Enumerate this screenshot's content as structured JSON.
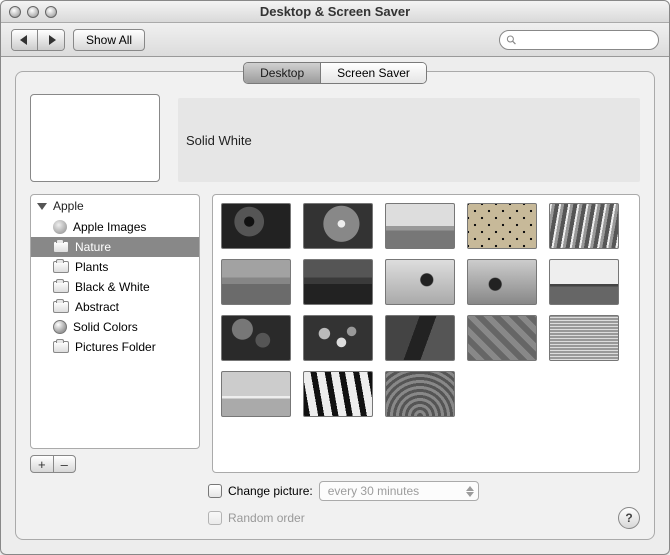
{
  "window": {
    "title": "Desktop & Screen Saver"
  },
  "toolbar": {
    "show_all": "Show All",
    "search_placeholder": ""
  },
  "tabs": {
    "desktop": "Desktop",
    "screensaver": "Screen Saver",
    "selected": "desktop"
  },
  "current": {
    "name": "Solid White"
  },
  "sidebar": {
    "group": "Apple",
    "items": [
      {
        "label": "Apple Images",
        "icon": "apple"
      },
      {
        "label": "Nature",
        "icon": "folder",
        "selected": true
      },
      {
        "label": "Plants",
        "icon": "folder"
      },
      {
        "label": "Black & White",
        "icon": "folder"
      },
      {
        "label": "Abstract",
        "icon": "folder"
      },
      {
        "label": "Solid Colors",
        "icon": "orb"
      },
      {
        "label": "Pictures Folder",
        "icon": "folder"
      }
    ],
    "add": "+",
    "remove": "–"
  },
  "thumbs_count": 18,
  "options": {
    "change_picture_label": "Change picture:",
    "interval": "every 30 minutes",
    "random_label": "Random order",
    "change_checked": false
  },
  "help": "?"
}
